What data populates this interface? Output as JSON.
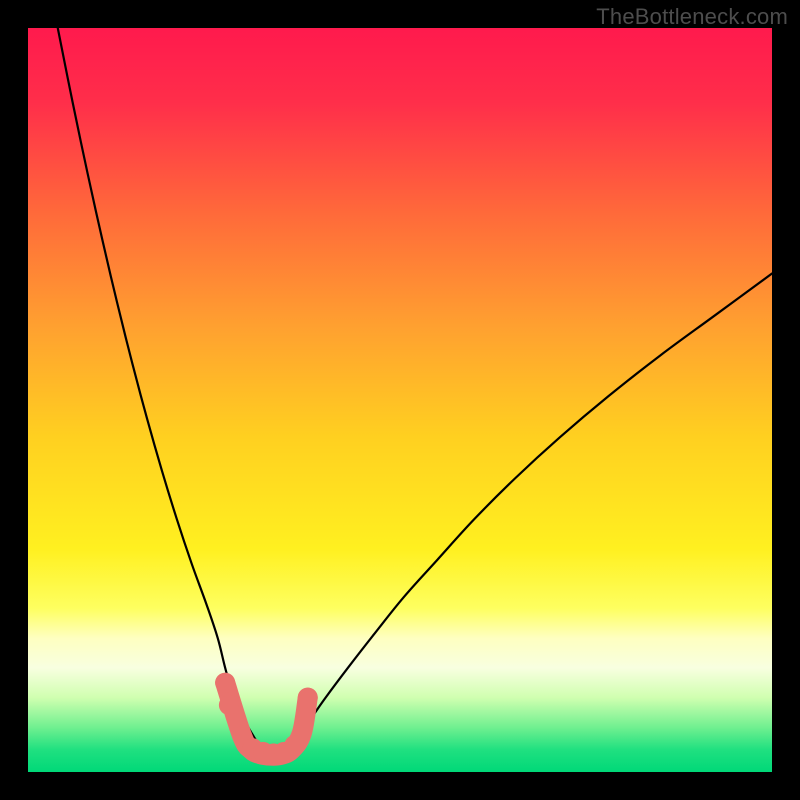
{
  "watermark": "TheBottleneck.com",
  "chart_data": {
    "type": "line",
    "title": "",
    "xlabel": "",
    "ylabel": "",
    "xlim": [
      0,
      100
    ],
    "ylim": [
      0,
      100
    ],
    "gradient_stops": [
      {
        "offset": 0.0,
        "color": "#ff1a4d"
      },
      {
        "offset": 0.1,
        "color": "#ff2e4a"
      },
      {
        "offset": 0.25,
        "color": "#ff6a3a"
      },
      {
        "offset": 0.4,
        "color": "#ffa030"
      },
      {
        "offset": 0.55,
        "color": "#ffd020"
      },
      {
        "offset": 0.7,
        "color": "#fff020"
      },
      {
        "offset": 0.78,
        "color": "#feff60"
      },
      {
        "offset": 0.82,
        "color": "#feffc0"
      },
      {
        "offset": 0.86,
        "color": "#f8ffe0"
      },
      {
        "offset": 0.9,
        "color": "#d0ffb0"
      },
      {
        "offset": 0.94,
        "color": "#70f090"
      },
      {
        "offset": 0.97,
        "color": "#20e080"
      },
      {
        "offset": 1.0,
        "color": "#00d878"
      }
    ],
    "series": [
      {
        "name": "curve-left",
        "x": [
          4,
          6,
          8,
          10,
          12,
          14,
          16,
          18,
          20,
          22,
          24,
          25.5,
          26.5,
          27.5,
          28.8,
          30.2,
          31.5,
          33.0
        ],
        "y": [
          100,
          90,
          80.5,
          71.5,
          63,
          55,
          47.5,
          40.5,
          34,
          28,
          22.5,
          18,
          14,
          10.5,
          7.5,
          5,
          3,
          1.8
        ]
      },
      {
        "name": "curve-right",
        "x": [
          33.0,
          35.0,
          37.5,
          40.0,
          43.0,
          46.5,
          50.5,
          55.0,
          60.0,
          65.5,
          71.5,
          78.0,
          85.0,
          92.5,
          100.0
        ],
        "y": [
          1.8,
          3.5,
          6.5,
          10.0,
          14.0,
          18.5,
          23.5,
          28.5,
          34.0,
          39.5,
          45.0,
          50.5,
          56.0,
          61.5,
          67.0
        ]
      },
      {
        "name": "bottom-band",
        "x": [
          26.5,
          28.8,
          30.0,
          31.2,
          32.6,
          34.0,
          35.4,
          36.8,
          37.6
        ],
        "y": [
          12.0,
          4.8,
          3.0,
          2.4,
          2.2,
          2.3,
          3.0,
          5.2,
          10.0
        ]
      }
    ],
    "scatter": {
      "name": "dots",
      "color": "#e9726d",
      "radius": 10,
      "points": [
        {
          "x": 26.5,
          "y": 12.0
        },
        {
          "x": 27.0,
          "y": 9.0
        },
        {
          "x": 28.8,
          "y": 4.8
        },
        {
          "x": 30.2,
          "y": 3.2
        },
        {
          "x": 31.6,
          "y": 2.7
        },
        {
          "x": 33.0,
          "y": 2.5
        },
        {
          "x": 34.4,
          "y": 2.7
        },
        {
          "x": 35.8,
          "y": 3.6
        },
        {
          "x": 37.6,
          "y": 10.0
        }
      ]
    }
  }
}
